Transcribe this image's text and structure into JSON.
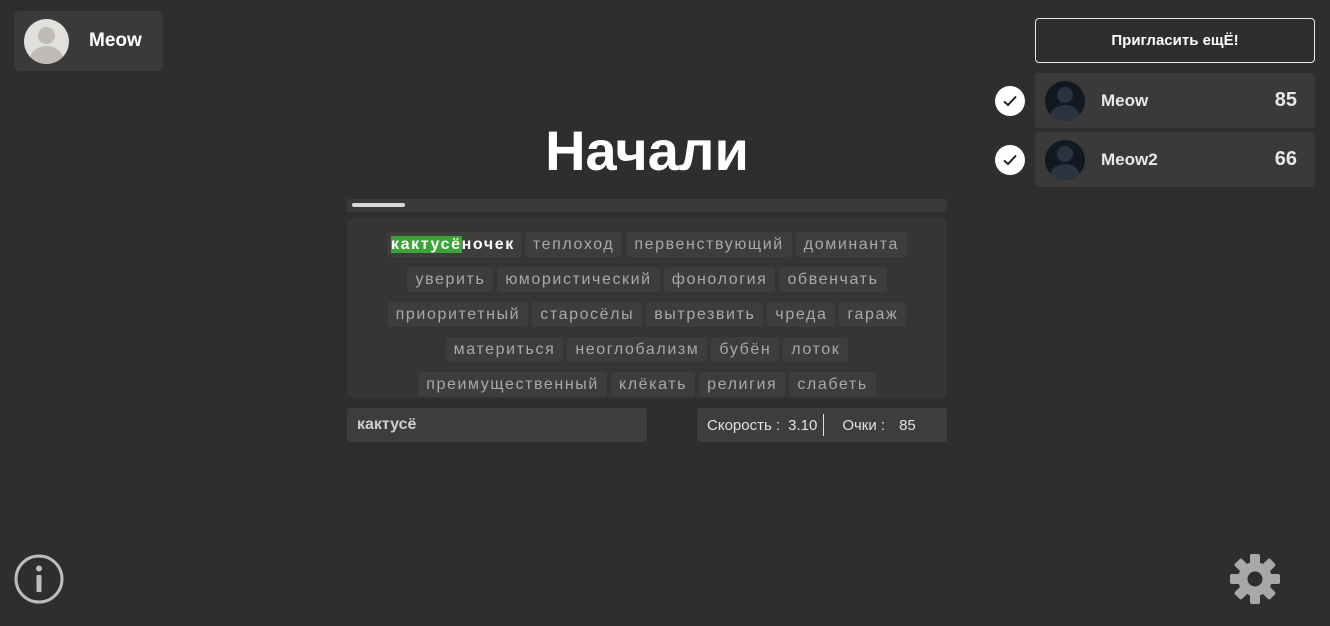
{
  "user": {
    "name": "Meow",
    "avatar_icon": "user-avatar-placeholder-icon"
  },
  "invite_button_label": "Пригласить ещЁ!",
  "players": [
    {
      "name": "Meow",
      "score": "85",
      "ready_icon": "check-icon"
    },
    {
      "name": "Meow2",
      "score": "66",
      "ready_icon": "check-icon"
    }
  ],
  "status_title": "Начали",
  "progress": {
    "fraction": 0.09
  },
  "current_word": {
    "typed": "кактусё",
    "rest": "ночек"
  },
  "words": [
    "теплоход",
    "первенствующий",
    "доминанта",
    "уверить",
    "юмористический",
    "фонология",
    "обвенчать",
    "приоритетный",
    "старосёлы",
    "вытрезвить",
    "чреда",
    "гараж",
    "материться",
    "неоглобализм",
    "бубён",
    "лоток",
    "преимущественный",
    "клёкать",
    "религия",
    "слабеть"
  ],
  "input": {
    "value": "кактусё"
  },
  "stats": {
    "speed_label": "Скорость :",
    "speed_value": "3.10",
    "points_label": "Очки :",
    "points_value": "85"
  },
  "icons": {
    "info": "info-icon",
    "settings": "gear-icon"
  },
  "colors": {
    "background": "#2e2e2e",
    "typed_highlight": "#3aa435"
  }
}
